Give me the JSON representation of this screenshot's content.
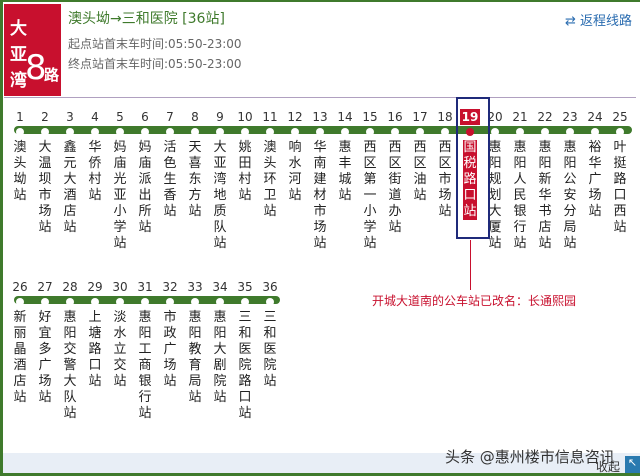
{
  "route": {
    "name_chars": [
      "大",
      "亚",
      "湾"
    ],
    "number": "8",
    "suffix": "路",
    "title": "澳头坳→三和医院 [36站]",
    "first_stop_time": "起点站首末车时间:05:50-23:00",
    "last_stop_time": "终点站首末车时间:05:50-23:00",
    "return_label": "返程线路"
  },
  "highlight_index": 18,
  "stations": [
    {
      "n": "1",
      "name": "澳头坳站"
    },
    {
      "n": "2",
      "name": "大温坝市场站"
    },
    {
      "n": "3",
      "name": "鑫元大酒店站"
    },
    {
      "n": "4",
      "name": "华侨村站"
    },
    {
      "n": "5",
      "name": "妈庙光亚小学站"
    },
    {
      "n": "6",
      "name": "妈庙派出所站"
    },
    {
      "n": "7",
      "name": "活色生香站"
    },
    {
      "n": "8",
      "name": "天喜东方站"
    },
    {
      "n": "9",
      "name": "大亚湾地质队站"
    },
    {
      "n": "10",
      "name": "姚田村站"
    },
    {
      "n": "11",
      "name": "澳头环卫站"
    },
    {
      "n": "12",
      "name": "响水河站"
    },
    {
      "n": "13",
      "name": "华南建材市场站"
    },
    {
      "n": "14",
      "name": "惠丰城站"
    },
    {
      "n": "15",
      "name": "西区第一小学站"
    },
    {
      "n": "16",
      "name": "西区街道办站"
    },
    {
      "n": "17",
      "name": "西区油站"
    },
    {
      "n": "18",
      "name": "西区市场站"
    },
    {
      "n": "19",
      "name": "国税路口站"
    },
    {
      "n": "20",
      "name": "惠阳规划大厦站"
    },
    {
      "n": "21",
      "name": "惠阳人民银行站"
    },
    {
      "n": "22",
      "name": "惠阳新华书店站"
    },
    {
      "n": "23",
      "name": "惠阳公安分局站"
    },
    {
      "n": "24",
      "name": "裕华广场站"
    },
    {
      "n": "25",
      "name": "叶挺路口西站"
    },
    {
      "n": "26",
      "name": "新丽晶酒店站"
    },
    {
      "n": "27",
      "name": "好宜多广场站"
    },
    {
      "n": "28",
      "name": "惠阳交警大队站"
    },
    {
      "n": "29",
      "name": "上塘路口站"
    },
    {
      "n": "30",
      "name": "淡水立交站"
    },
    {
      "n": "31",
      "name": "惠阳工商银行站"
    },
    {
      "n": "32",
      "name": "市政广场站"
    },
    {
      "n": "33",
      "name": "惠阳教育局站"
    },
    {
      "n": "34",
      "name": "惠阳大剧院站"
    },
    {
      "n": "35",
      "name": "三和医院路口站"
    },
    {
      "n": "36",
      "name": "三和医院站"
    }
  ],
  "note": "开城大道南的公车站已改名：长通熙园",
  "watermark": "头条 @惠州楼市信息咨讯",
  "collapse_label": "收起"
}
